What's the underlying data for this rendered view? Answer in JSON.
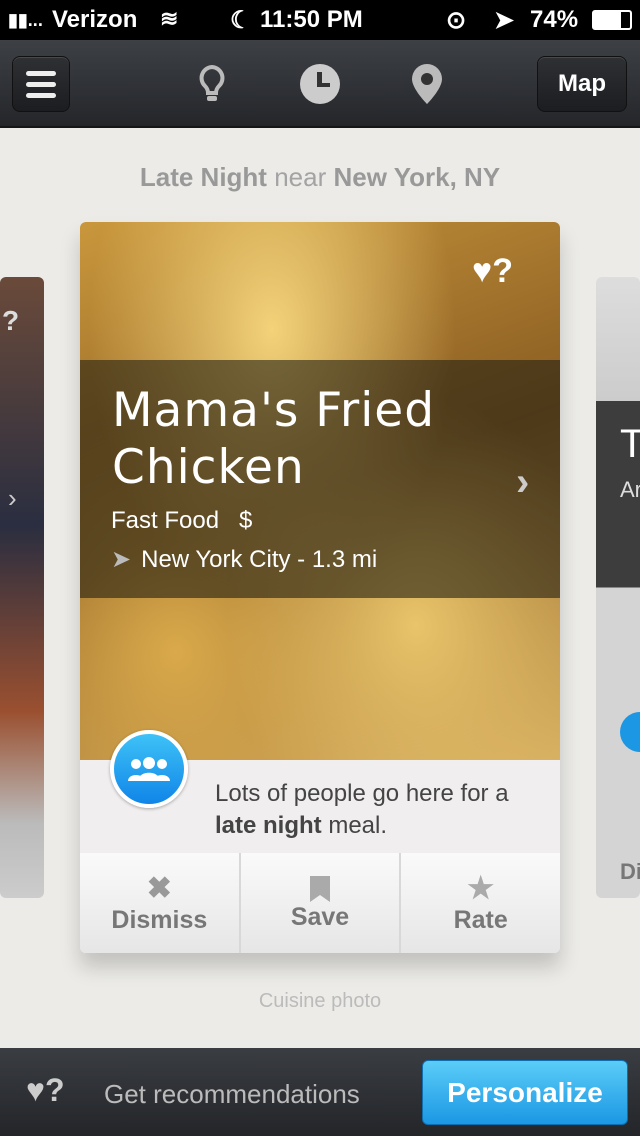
{
  "status_bar": {
    "carrier": "Verizon",
    "time": "11:50 PM",
    "battery": "74%",
    "battery_level": 74
  },
  "nav": {
    "menu_icon": "hamburger-icon",
    "tabs": [
      {
        "icon": "lightbulb-icon"
      },
      {
        "icon": "clock-icon",
        "active": true
      },
      {
        "icon": "location-pin-icon"
      }
    ],
    "map_label": "Map"
  },
  "subtitle": {
    "time_of_day": "Late Night",
    "near": "near",
    "location": "New York, NY"
  },
  "card": {
    "name": "Mama's Fried Chicken",
    "category": "Fast Food",
    "price": "$",
    "location": "New York City - 1.3 mi",
    "favorite_hint": "?",
    "reason_prefix": "Lots of people go here for a ",
    "reason_bold": "late night",
    "reason_suffix": " meal.",
    "actions": [
      {
        "label": "Dismiss",
        "icon": "x-icon"
      },
      {
        "label": "Save",
        "icon": "bookmark-icon"
      },
      {
        "label": "Rate",
        "icon": "star-icon"
      }
    ]
  },
  "side_cards": {
    "left_hint": "?",
    "right_title": "T",
    "right_sub": "Ar",
    "right_action": "Di"
  },
  "caption": "Cuisine photo",
  "bottom": {
    "hint": "?",
    "text": "Get recommendations",
    "button": "Personalize"
  },
  "colors": {
    "accent": "#1b97e4",
    "nav": "#2e3034",
    "background": "#ecebe7"
  }
}
